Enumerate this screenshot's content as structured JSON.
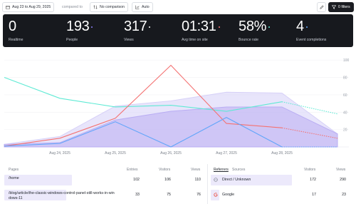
{
  "toolbar": {
    "date_range": "Aug 23 to Aug 29, 2025",
    "compared_to": "compared to",
    "comparison": "No comparison",
    "interval": "Auto",
    "filters": "0 filters"
  },
  "metrics": [
    {
      "value": "0",
      "label": "Realtime",
      "dot_color": ""
    },
    {
      "value": "193",
      "label": "People",
      "dot_color": "#8b7cf6"
    },
    {
      "value": "317",
      "label": "Views",
      "dot_color": "#ffffff"
    },
    {
      "value": "01:31",
      "label": "Avg time on site",
      "dot_color": "#f47272"
    },
    {
      "value": "58%",
      "label": "Bounce rate",
      "dot_color": "#5eead4"
    },
    {
      "value": "4",
      "label": "Event completions",
      "dot_color": "#60a5fa"
    }
  ],
  "chart_data": {
    "type": "area",
    "categories": [
      "Aug 23",
      "Aug 24, 2025",
      "Aug 25, 2025",
      "Aug 26, 2025",
      "Aug 27, 2025",
      "Aug 28, 2025",
      "Aug 29"
    ],
    "x_tick_labels": [
      "Aug 24, 2025",
      "Aug 25, 2025",
      "Aug 26, 2025",
      "Aug 27, 2025",
      "Aug 28, 2025"
    ],
    "y_ticks": [
      "100",
      "80",
      "60",
      "40",
      "20"
    ],
    "ylim": [
      0,
      110
    ],
    "grid": true,
    "series": [
      {
        "values": [
          3,
          12,
          47,
          53,
          63,
          62,
          15
        ],
        "color": "#d6d0f7",
        "kind": "area"
      },
      {
        "values": [
          3,
          5,
          31,
          41,
          46,
          46,
          15
        ],
        "color": "#b9adf3",
        "kind": "area"
      },
      {
        "values": [
          80,
          56,
          46,
          48,
          41,
          52,
          38
        ],
        "color": "#5eead4",
        "kind": "line"
      },
      {
        "values": [
          1,
          10,
          33,
          94,
          27,
          22,
          10
        ],
        "color": "#f47272",
        "kind": "line"
      },
      {
        "values": [
          1,
          4,
          29,
          0,
          34,
          0,
          0
        ],
        "color": "#60a5fa",
        "kind": "line"
      }
    ]
  },
  "pages_table": {
    "tab": "Pages",
    "columns": [
      "Entries",
      "Visitors",
      "Views"
    ],
    "rows": [
      {
        "path": "/home",
        "entries": "102",
        "visitors": "106",
        "views": "110",
        "share": 0.6
      },
      {
        "path": "/blog/article/the-classic-windows-control-panel-still-works-in-windows-11",
        "entries": "33",
        "visitors": "75",
        "views": "76",
        "share": 0.55
      }
    ]
  },
  "referrers_table": {
    "tab_active": "Referrers",
    "tab_other": "Sources",
    "columns": [
      "Visitors",
      "Views"
    ],
    "rows": [
      {
        "name": "Direct / Unknown",
        "visitors": "172",
        "views": "290",
        "share": 0.95
      },
      {
        "name": "Google",
        "visitors": "17",
        "views": "23",
        "share": 0.1
      }
    ]
  }
}
